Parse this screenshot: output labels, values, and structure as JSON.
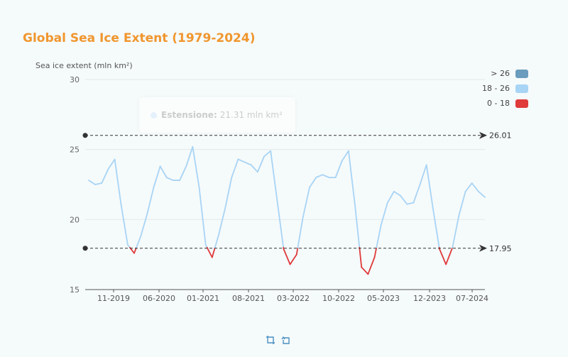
{
  "chart_data": {
    "type": "line",
    "title": "Global Sea Ice Extent (1979-2024)",
    "ylabel": "Sea ice extent (mln km²)",
    "xlabel": "",
    "ylim": [
      15,
      30
    ],
    "y_ticks": [
      "15",
      "20",
      "25",
      "30"
    ],
    "x_ticks": [
      "11-2019",
      "06-2020",
      "01-2021",
      "08-2021",
      "03-2022",
      "10-2022",
      "05-2023",
      "12-2023",
      "07-2024"
    ],
    "grid": true,
    "series": [
      {
        "values": [
          22.8,
          22.5,
          22.6,
          23.6,
          24.3,
          21.0,
          18.2,
          17.6,
          18.8,
          20.4,
          22.3,
          23.8,
          23.0,
          22.8,
          22.8,
          23.8,
          25.2,
          22.3,
          18.2,
          17.3,
          18.9,
          20.8,
          23.0,
          24.3,
          24.1,
          23.9,
          23.4,
          24.5,
          24.9,
          21.4,
          17.9,
          16.8,
          17.5,
          20.2,
          22.3,
          23.0,
          23.2,
          23.0,
          23.0,
          24.2,
          24.9,
          21.0,
          16.6,
          16.1,
          17.3,
          19.6,
          21.2,
          22.0,
          21.7,
          21.1,
          21.2,
          22.5,
          23.9,
          20.8,
          17.9,
          16.8,
          18.0,
          20.3,
          22.0,
          22.6,
          22.0,
          21.6
        ]
      }
    ],
    "visual_map": [
      {
        "label": "> 26",
        "color": "#6a9cbd"
      },
      {
        "label": "18 - 26",
        "color": "#a8d4f5"
      },
      {
        "label": "0 - 18",
        "color": "#e03a3a"
      }
    ],
    "mark_lines": [
      {
        "value": 26.01,
        "label": "26.01"
      },
      {
        "value": 17.95,
        "label": "17.95"
      }
    ],
    "tooltip": {
      "key": "Estensione:",
      "value": "21.31 mln km²"
    }
  }
}
